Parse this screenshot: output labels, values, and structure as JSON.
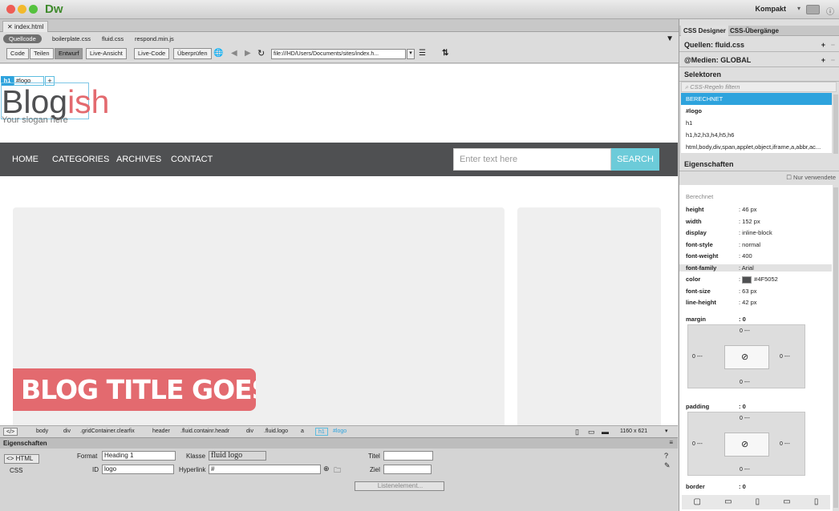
{
  "app": {
    "name": "Dw",
    "workspace": "Kompakt"
  },
  "doc_tab": "index.html",
  "related_files": [
    "Quellcode",
    "boilerplate.css",
    "fluid.css",
    "respond.min.js"
  ],
  "view_buttons": [
    "Code",
    "Teilen",
    "Entwurf",
    "Live-Ansicht",
    "Live-Code",
    "Überprüfen"
  ],
  "url": "file:///HD/Users/Documents/sites/index.h...",
  "element_tag": {
    "tag": "h1",
    "id": "#logo",
    "add": "+"
  },
  "page": {
    "logo_dark": "Blog",
    "logo_accent": "ish",
    "slogan": "Your slogan here",
    "nav": [
      "HOME",
      "CATEGORIES",
      "ARCHIVES",
      "CONTACT"
    ],
    "search_placeholder": "Enter text here",
    "search_button": "SEARCH",
    "banner": "BLOG TITLE GOES HERE"
  },
  "statusbar": {
    "tags": [
      "</>",
      "body",
      "div",
      ".gridContainer.clearfix",
      "header",
      ".fluid.containr.headr",
      "div",
      ".fluid.logo",
      "a",
      "h1",
      "#logo"
    ],
    "size": "1160 x 621"
  },
  "properties": {
    "title": "Eigenschaften",
    "html": "<> HTML",
    "css": "CSS",
    "format_label": "Format",
    "format_value": "Heading 1",
    "class_label": "Klasse",
    "class_value": "fluid logo",
    "title_label": "Titel",
    "id_label": "ID",
    "id_value": "logo",
    "link_label": "Hyperlink",
    "link_value": "#",
    "target_label": "Ziel",
    "list_button": "Listenelement..."
  },
  "right_panel": {
    "tabs": [
      "CSS Designer",
      "CSS-Übergänge"
    ],
    "sources": "Quellen: fluid.css",
    "media": "@Medien: GLOBAL",
    "selectors_title": "Selektoren",
    "filter_placeholder": "CSS-Regeln filtern",
    "selectors": [
      "BERECHNET",
      "#logo",
      "h1",
      "h1,h2,h3,h4,h5,h6",
      "html,body,div,span,applet,object,iframe,a,abbr,ac..."
    ],
    "props_title": "Eigenschaften",
    "only_used": "Nur verwendete",
    "computed": "Berechnet",
    "props": [
      {
        "k": "height",
        "v": "46 px"
      },
      {
        "k": "width",
        "v": "152 px"
      },
      {
        "k": "display",
        "v": "inline-block"
      },
      {
        "k": "font-style",
        "v": "normal"
      },
      {
        "k": "font-weight",
        "v": "400"
      },
      {
        "k": "font-family",
        "v": "Arial"
      },
      {
        "k": "color",
        "v": "#4F5052"
      },
      {
        "k": "font-size",
        "v": "63 px"
      },
      {
        "k": "line-height",
        "v": "42 px"
      }
    ],
    "margin": {
      "label": "margin",
      "value": "0",
      "top": "0 ---",
      "left": "0 ---",
      "right": "0 ---",
      "bottom": "0 ---"
    },
    "padding": {
      "label": "padding",
      "value": "0",
      "top": "0 ---",
      "left": "0 ---",
      "right": "0 ---",
      "bottom": "0 ---"
    },
    "border": {
      "label": "border",
      "value": "0"
    }
  },
  "colors": {
    "accent": "#e36a6f",
    "nav": "#4f5052",
    "search": "#6ccbd9",
    "selection": "#2ea3dd"
  }
}
